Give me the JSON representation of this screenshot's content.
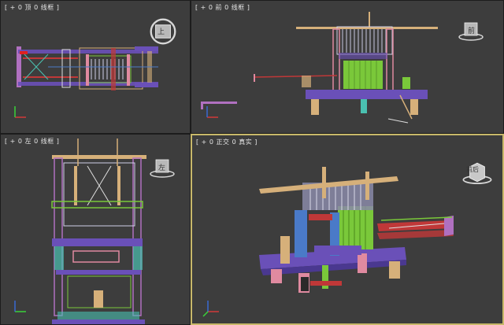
{
  "viewports": {
    "top": {
      "label": "[ + 0 顶 0 线框 ]",
      "cube": "上"
    },
    "front": {
      "label": "[ + 0 前 0 线框 ]",
      "cube": "前"
    },
    "left": {
      "label": "[ + 0 左 0 线框 ]",
      "cube": "左"
    },
    "persp": {
      "label": "[ + 0 正交 0 真实 ]",
      "cube": "前后"
    }
  },
  "colors": {
    "viewport_bg": "#3d3d3d",
    "active_border": "#c8b86a",
    "purple": "#6a50b8",
    "green": "#7ac83a",
    "pink": "#e08aa0",
    "tan": "#d6b07a",
    "teal": "#4ac0b0",
    "red": "#c03838",
    "axis_x": "#d23a3a",
    "axis_y": "#3ad23a",
    "axis_z": "#3a6ad2"
  },
  "icons": [
    "viewcube-icon",
    "axis-tripod-icon"
  ]
}
